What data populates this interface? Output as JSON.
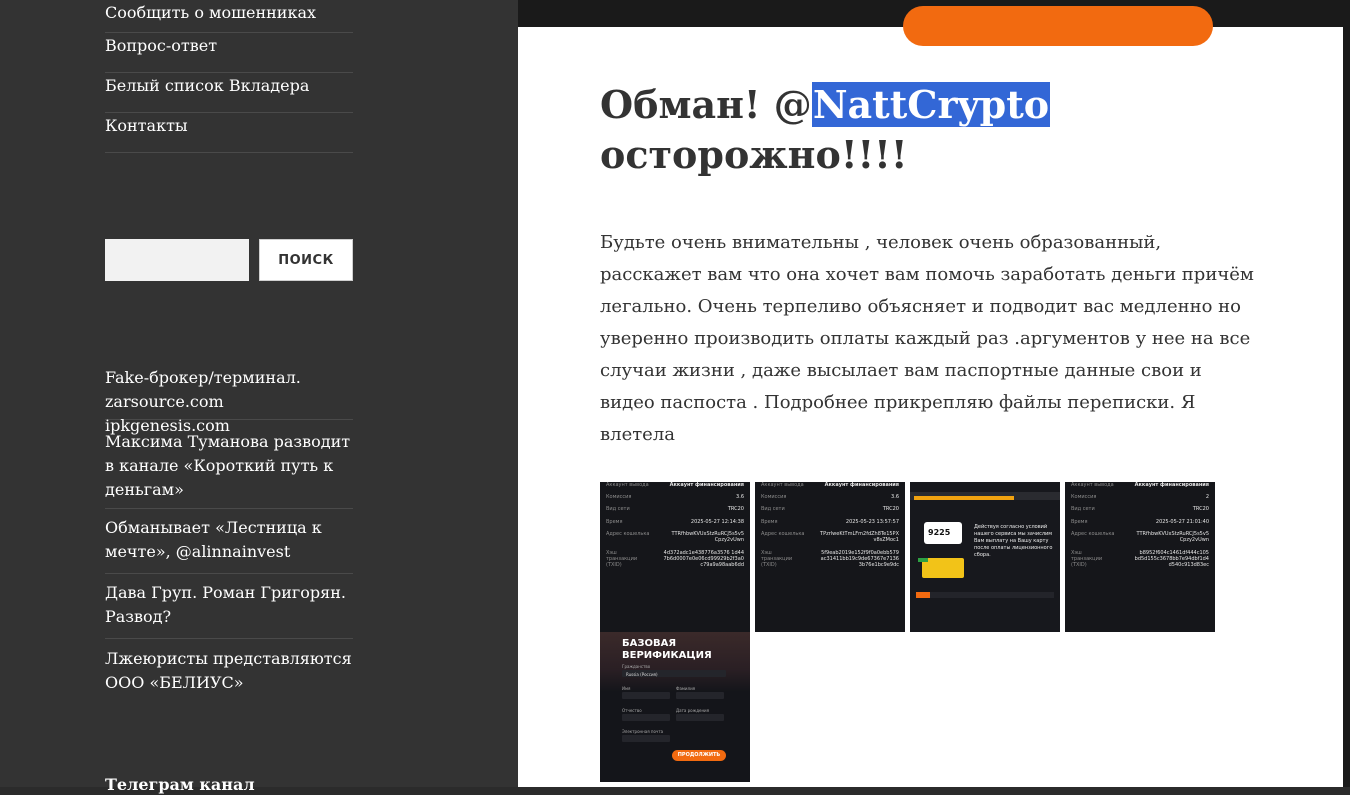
{
  "sidebar": {
    "menu": [
      "Сообщить о мошенниках",
      "Вопрос-ответ",
      "Белый список Вкладера",
      "Контакты"
    ],
    "search": {
      "placeholder": "",
      "button_label": "ПОИСК"
    },
    "recent_posts": [
      "Fake-брокер/терминал. zarsource.com ipkgenesis.com",
      "Максима Туманова разводит в канале «Короткий путь к деньгам»",
      "Обманывает «Лестница к мечте», @alinnainvest",
      "Дава Груп. Роман Григорян. Развод?",
      "Лжеюристы представляются ООО «БЕЛИУС»"
    ],
    "next_widget_title": "Телеграм канал"
  },
  "article": {
    "title_before": "Обман! @",
    "title_selected": "NattCrypto",
    "title_after": "осторожно!!!!",
    "body": "Будьте очень внимательны , человек очень образованный, расскажет вам что она хочет вам помочь заработать деньги причём легально. Очень терпеливо объясняет и подводит вас медленно но уверенно производить оплаты каждый раз .аргументов у нее на все случаи жизни , даже высылает вам паспортные данные свои и видео паспоста . Подробнее прикрепляю файлы переписки. Я влетела"
  },
  "gallery": {
    "receipt1": {
      "hdr_l": "Аккаунт вывода",
      "hdr_r": "Аккаунт финансирования",
      "rows": [
        [
          "Комиссия",
          "3.6"
        ],
        [
          "Вид сети",
          "TRC20"
        ],
        [
          "Время",
          "2025-05-27 12:14:38"
        ],
        [
          "Адрес кошелька",
          "TTRfhbwKVUxStzRuRCJ5s5v5 Cpzy2vUwn"
        ],
        [
          "Хэш транзакции (TXID)",
          "4d372adc1e438776a3576 1d44 7b6d0007e0e06cd99929b2f3a0 c79a9a98aab6dd"
        ]
      ]
    },
    "receipt2": {
      "hdr_l": "Аккаунт вывода",
      "hdr_r": "Аккаунт финансирования",
      "rows": [
        [
          "Комиссия",
          "3.6"
        ],
        [
          "Вид сети",
          "TRC20"
        ],
        [
          "Время",
          "2025-05-23 13:57:57"
        ],
        [
          "Адрес кошелька",
          "TPzrlweKtTmLFm2fdZh8Te15PX v8sZMoc1"
        ],
        [
          "Хэш транзакции (TXID)",
          "5f9eab2019e152f9f0a0ebb579 ac31411bb19c9de67367e7136 3b76e1bc9e9dc"
        ]
      ]
    },
    "receipt3": {
      "card_value": "9225",
      "text": "Действуя согласно условий нашего сервиса мы зачислим Вам выплату на Вашу карту после оплаты лицензионного сбора."
    },
    "receipt4": {
      "hdr_l": "Аккаунт вывода",
      "hdr_r": "Аккаунт финансирования",
      "rows": [
        [
          "Комиссия",
          "2"
        ],
        [
          "Вид сети",
          "TRC20"
        ],
        [
          "Время",
          "2025-05-27 21:01:40"
        ],
        [
          "Адрес кошелька",
          "TTRfhbwKVUxStzRuRCJ5s5v5 Cpzy2vUwn"
        ],
        [
          "Хэш транзакции (TXID)",
          "b8952f604c1461df444c105 bd5d155c3678bb7e94dbf1d4 d540c913d83ec"
        ]
      ]
    },
    "verification": {
      "title": "БАЗОВАЯ ВЕРИФИКАЦИЯ",
      "citizenship_label": "Гражданство",
      "citizenship_value": "Russia (Россия)",
      "name_label": "Имя",
      "surname_label": "Фамилия",
      "patronymic_label": "Отчество",
      "birthdate_label": "Дата рождения",
      "email_label": "Электронная почта",
      "continue_button": "ПРОДОЛЖИТЬ"
    }
  },
  "colors": {
    "sidebar_bg": "#333333",
    "selection": "#3367d6",
    "accent_orange": "#f26a10"
  }
}
